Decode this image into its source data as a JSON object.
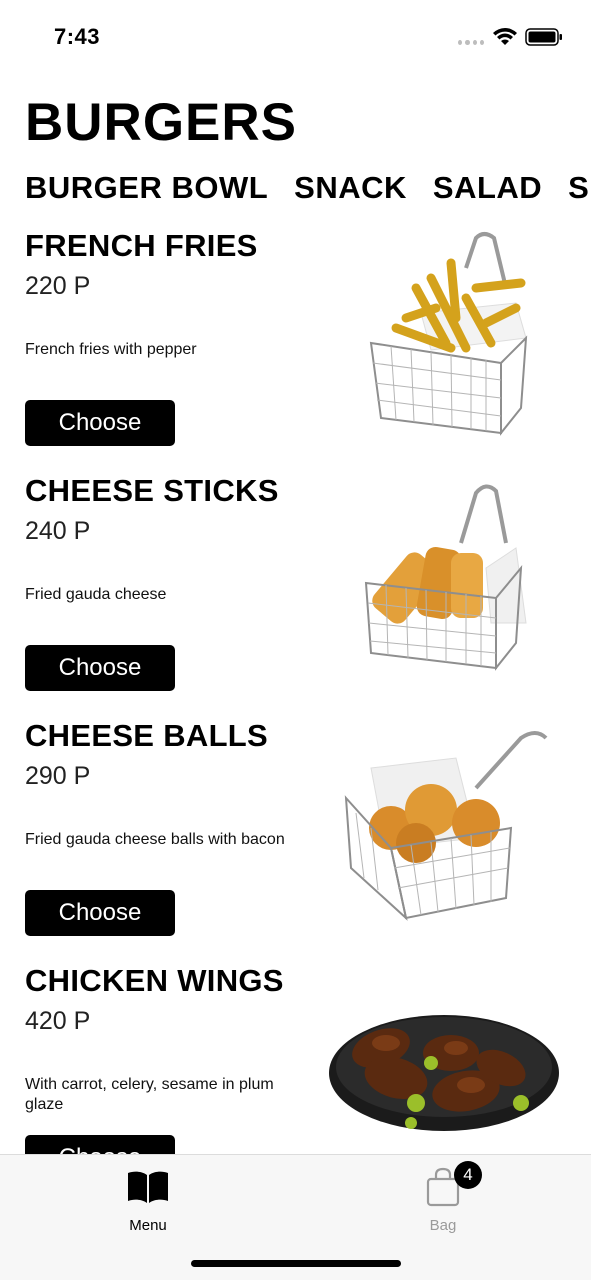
{
  "status_bar": {
    "time": "7:43"
  },
  "header": {
    "title": "BURGERS"
  },
  "categories": [
    "BURGER BOWL",
    "SNACK",
    "SALAD",
    "S"
  ],
  "products": [
    {
      "name": "FRENCH FRIES",
      "price": "220 P",
      "description": "French fries with pepper",
      "button": "Choose"
    },
    {
      "name": "CHEESE STICKS",
      "price": "240 P",
      "description": "Fried gauda cheese",
      "button": "Choose"
    },
    {
      "name": "CHEESE BALLS",
      "price": "290 P",
      "description": "Fried gauda cheese balls with bacon",
      "button": "Choose"
    },
    {
      "name": "CHICKEN WINGS",
      "price": "420 P",
      "description": "With carrot, celery, sesame in plum glaze",
      "button": "Choose"
    }
  ],
  "tab_bar": {
    "menu_label": "Menu",
    "bag_label": "Bag",
    "bag_count": "4"
  },
  "icons": {
    "menu": "open-book-icon",
    "bag": "shopping-bag-icon",
    "wifi": "wifi-icon",
    "battery": "battery-icon"
  },
  "colors": {
    "primary": "#000000",
    "background": "#ffffff",
    "tab_inactive": "#9a9a9a"
  }
}
